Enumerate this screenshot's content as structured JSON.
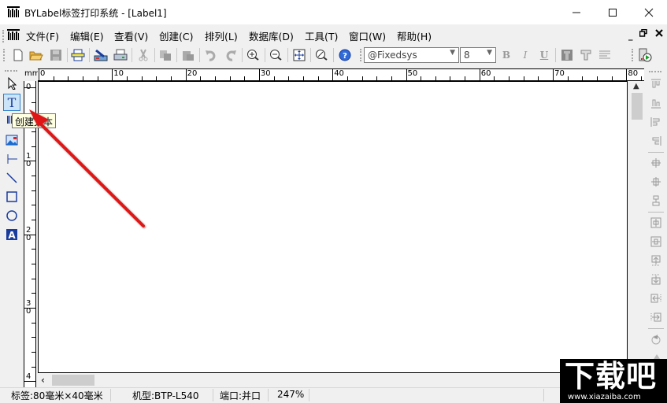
{
  "window": {
    "title": "BYLabel标签打印系统 - [Label1]",
    "minimize_icon": "minimize-icon",
    "maximize_icon": "maximize-icon",
    "close_icon": "close-icon"
  },
  "menubar": {
    "items": [
      {
        "label": "文件(F)"
      },
      {
        "label": "编辑(E)"
      },
      {
        "label": "查看(V)"
      },
      {
        "label": "创建(C)"
      },
      {
        "label": "排列(L)"
      },
      {
        "label": "数据库(D)"
      },
      {
        "label": "工具(T)"
      },
      {
        "label": "窗口(W)"
      },
      {
        "label": "帮助(H)"
      }
    ],
    "mdi": {
      "minimize": "_",
      "restore": "🗗",
      "close": "✕"
    }
  },
  "toolbar": {
    "buttons": [
      {
        "name": "new-icon"
      },
      {
        "name": "open-icon"
      },
      {
        "name": "save-icon"
      },
      {
        "name": "page-setup-icon"
      },
      {
        "name": "printer-setup-icon"
      },
      {
        "name": "print-icon"
      },
      {
        "name": "cut-icon"
      },
      {
        "name": "copy-icon"
      },
      {
        "name": "paste-icon"
      },
      {
        "name": "undo-icon"
      },
      {
        "name": "redo-icon"
      },
      {
        "name": "zoom-in-icon"
      },
      {
        "name": "zoom-out-icon"
      },
      {
        "name": "fit-page-icon"
      },
      {
        "name": "zoom-custom-icon"
      },
      {
        "name": "help-icon"
      }
    ],
    "font_name": "@Fixedsys",
    "font_size": "8",
    "bold": "B",
    "italic": "I",
    "underline": "U"
  },
  "left_tools": {
    "items": [
      {
        "name": "select-tool"
      },
      {
        "name": "text-tool",
        "active": true
      },
      {
        "name": "barcode-tool"
      },
      {
        "name": "image-tool"
      },
      {
        "name": "hline-tool"
      },
      {
        "name": "line-tool"
      },
      {
        "name": "rectangle-tool"
      },
      {
        "name": "ellipse-tool"
      },
      {
        "name": "wordart-tool"
      }
    ],
    "tooltip": "创建文本"
  },
  "ruler": {
    "unit": "mm",
    "h_labels": [
      "0",
      "10",
      "20",
      "30",
      "40",
      "50",
      "60",
      "70",
      "80"
    ],
    "v_labels": [
      [
        "0",
        ""
      ],
      [
        "1",
        "0"
      ],
      [
        "2",
        "0"
      ],
      [
        "3",
        "0"
      ],
      [
        "4",
        ""
      ]
    ]
  },
  "statusbar": {
    "label_size": "标签:80毫米×40毫米",
    "model": "机型:BTP-L540",
    "port": "端口:并口",
    "zoom": "247%"
  },
  "watermark": {
    "title": "下载吧",
    "url": "www.xiazaiba.com"
  }
}
